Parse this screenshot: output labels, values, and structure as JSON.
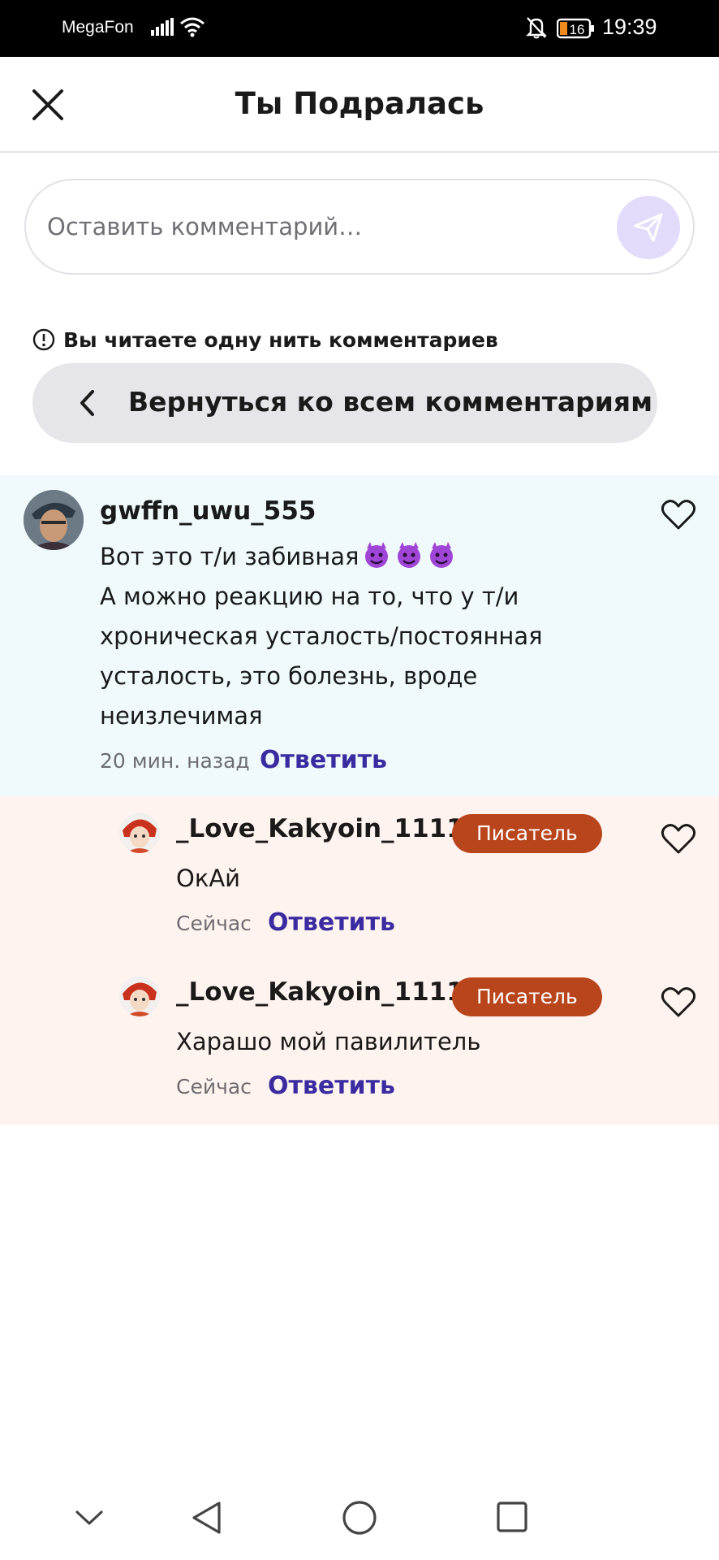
{
  "status_bar": {
    "carrier": "MegaFon",
    "battery_level": "16",
    "time": "19:39"
  },
  "header": {
    "title": "Ты Подралась"
  },
  "comment_input": {
    "placeholder": "Оставить комментарий…"
  },
  "thread": {
    "notice": "Вы читаете одну нить комментариев",
    "back_label": "Вернуться ко всем комментариям"
  },
  "comments": [
    {
      "username": "gwffn_uwu_555",
      "line1": "Вот это т/и забивная",
      "emoji": "😈😈😈",
      "body": "А можно реакцию на то, что у т/и хроническая усталость/постоянная усталость, это болезнь, вроде неизлечимая",
      "time": "20 мин. назад",
      "reply_label": "Ответить"
    }
  ],
  "replies": [
    {
      "username": "_Love_Kakyoin_1111",
      "badge": "Писатель",
      "body": "ОкАй",
      "time": "Сейчас",
      "reply_label": "Ответить"
    },
    {
      "username": "_Love_Kakyoin_1111",
      "badge": "Писатель",
      "body": "Харашо мой павилитель",
      "time": "Сейчас",
      "reply_label": "Ответить"
    }
  ],
  "colors": {
    "accent": "#3a2ba0",
    "badge": "#b9451c",
    "main_comment_bg": "#f0fafd",
    "reply_bg": "#fff3f0",
    "send_button_bg": "#e2dcfa"
  },
  "icons": [
    "signal-icon",
    "wifi-icon",
    "bell-off-icon",
    "battery-icon",
    "close-icon",
    "send-icon",
    "info-icon",
    "chevron-left-icon",
    "heart-icon",
    "devil-emoji",
    "nav-collapse-icon",
    "nav-back-icon",
    "nav-home-icon",
    "nav-recents-icon"
  ]
}
